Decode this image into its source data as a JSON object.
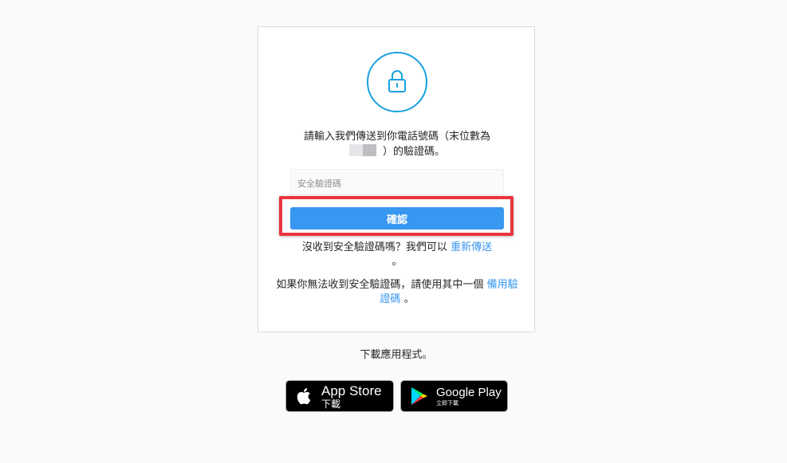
{
  "card": {
    "lock_icon": "lock-icon",
    "instruction_line1": "請輸入我們傳送到你電話號碼（末位數為",
    "instruction_line2_suffix": "）的驗證碼。",
    "code_input": {
      "value": "",
      "placeholder": "安全驗證碼"
    },
    "confirm_label": "確認",
    "resend_prefix": "沒收到安全驗證碼嗎？我們可以",
    "resend_link": "重新傳送",
    "resend_suffix": "。",
    "backup_prefix": "如果你無法收到安全驗證碼，請使用其中一個",
    "backup_link": "備用驗證碼",
    "backup_suffix": "。"
  },
  "download": {
    "text": "下載應用程式。",
    "app_store": {
      "icon": "apple-icon",
      "title": "App Store",
      "subtitle": "下載"
    },
    "google_play": {
      "icon": "google-play-icon",
      "title": "Google Play",
      "subtitle": "立即下載"
    }
  },
  "colors": {
    "background": "#fafafa",
    "card_border": "#dbdbdb",
    "lock_accent": "#1aa1e0",
    "primary_button": "#3897f0",
    "link": "#3897f0",
    "highlight_border": "#e8353f"
  }
}
